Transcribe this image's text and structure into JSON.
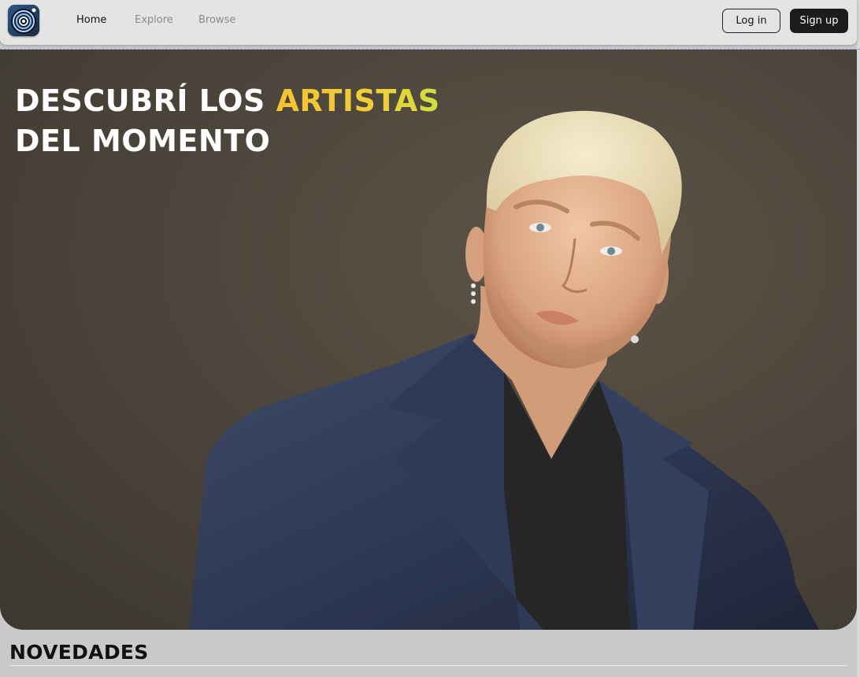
{
  "navbar": {
    "logo_icon": "vinyl-record-icon",
    "links": [
      {
        "label": "Home",
        "active": true
      },
      {
        "label": "Explore",
        "active": false
      },
      {
        "label": "Browse",
        "active": false
      }
    ],
    "login_label": "Log in",
    "signup_label": "Sign up"
  },
  "hero": {
    "title_part1": "DESCUBRÍ LOS ",
    "title_accent": "ARTISTAS",
    "title_line2": "DEL MOMENTO",
    "accent_color": "#f4c233",
    "background_color": "#4d463c"
  },
  "section": {
    "title": "NOVEDADES"
  }
}
